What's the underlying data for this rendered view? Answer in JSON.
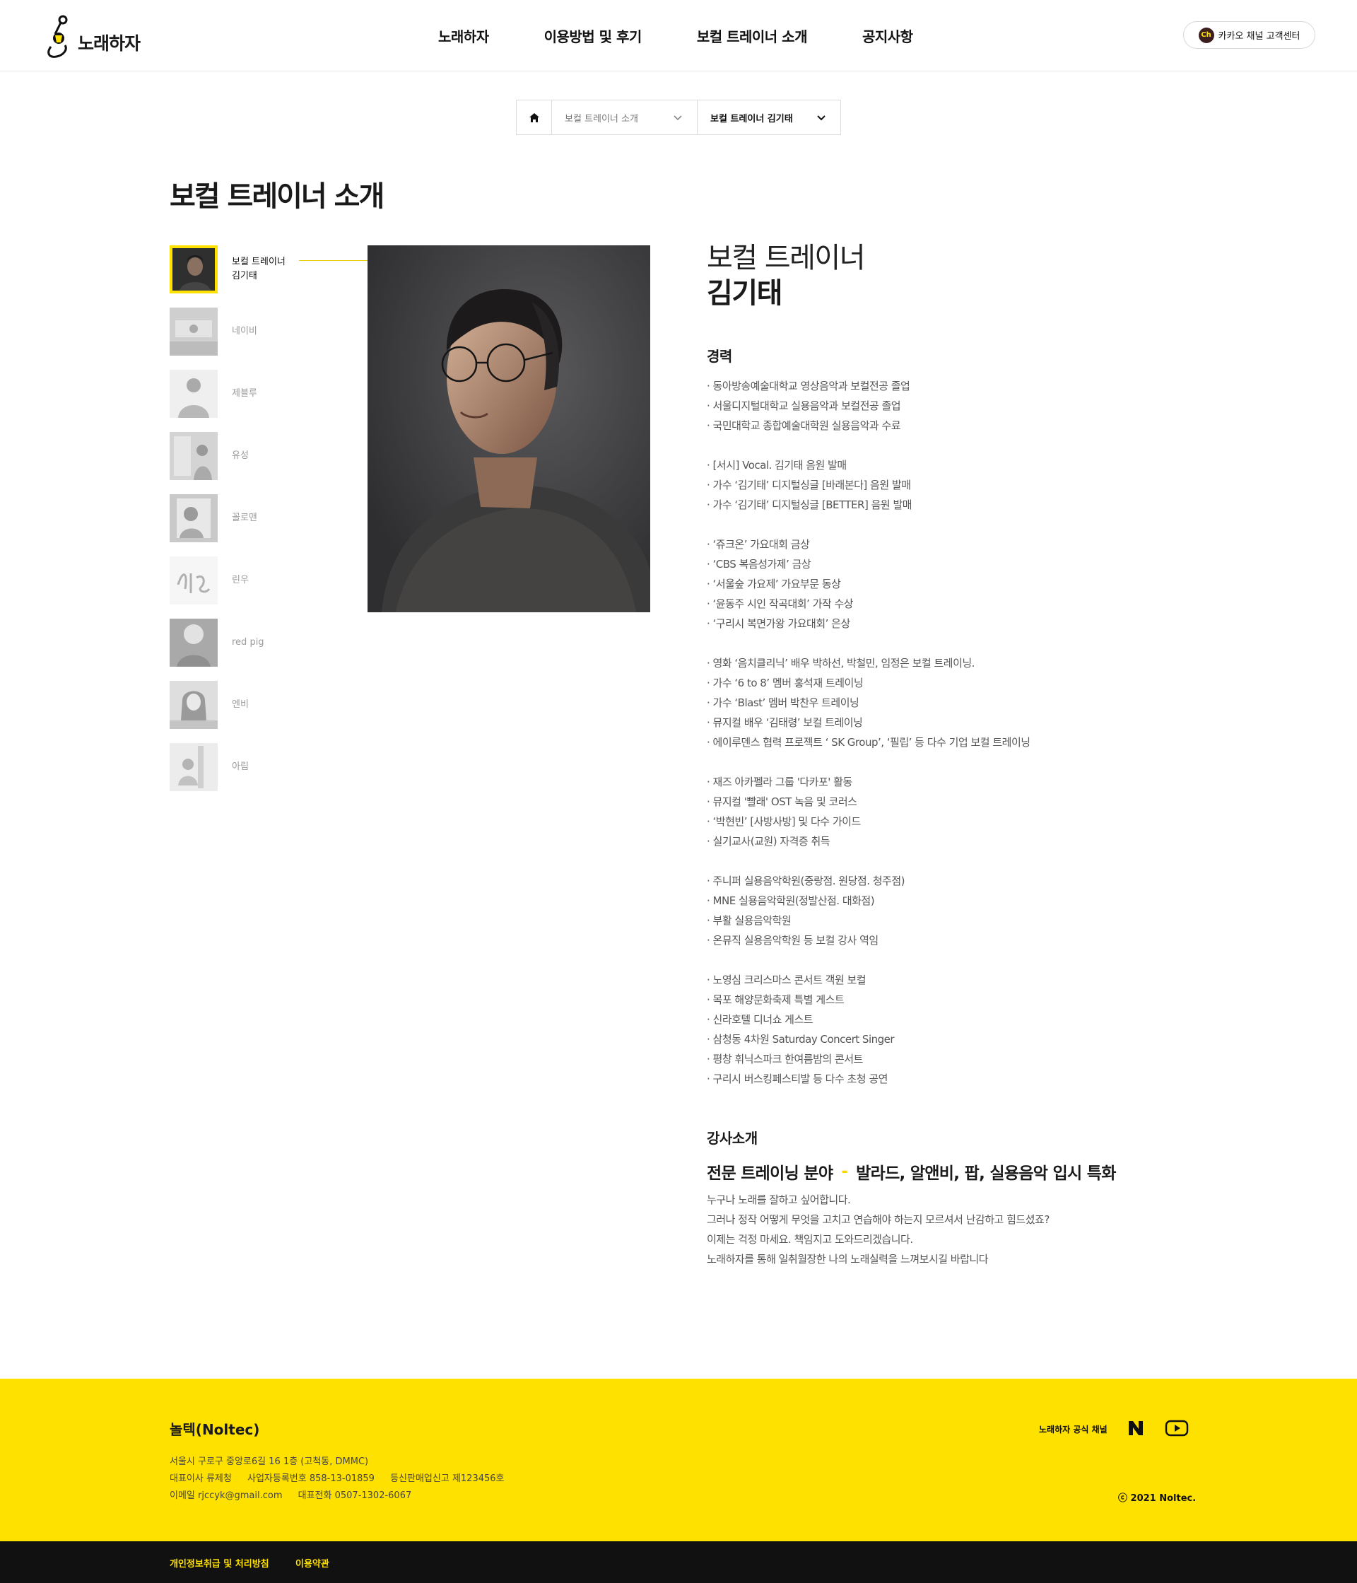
{
  "header": {
    "logo_text": "노래하자",
    "nav": [
      "노래하자",
      "이용방법 및 후기",
      "보컬 트레이너 소개",
      "공지사항"
    ],
    "active_nav": "보컬 트레이너 소개",
    "kakao_icon": "Ch",
    "kakao_label": "카카오 채널 고객센터"
  },
  "breadcrumb": {
    "home_icon": "home-icon",
    "section": "보컬 트레이너 소개",
    "current": "보컬 트레이너 김기태"
  },
  "page_title": "보컬 트레이너 소개",
  "trainers": [
    {
      "role": "보컬 트레이너",
      "name": "김기태",
      "active": true
    },
    {
      "name": "네이비"
    },
    {
      "name": "제블루"
    },
    {
      "name": "유성"
    },
    {
      "name": "꼴로맨"
    },
    {
      "name": "린우"
    },
    {
      "name": "red pig"
    },
    {
      "name": "엔비"
    },
    {
      "name": "아림"
    }
  ],
  "profile": {
    "role": "보컬 트레이너",
    "name": "김기태",
    "career_title": "경력",
    "career_groups": [
      [
        "· 동아방송예술대학교 영상음악과 보컬전공 졸업",
        "· 서울디지털대학교 실용음악과 보컬전공 졸업",
        "· 국민대학교 종합예술대학원 실용음악과 수료"
      ],
      [
        "· [서시] Vocal. 김기태 음원 발매",
        "· 가수 ‘김기태’ 디지털싱글 [바래본다] 음원 발매",
        "· 가수 ‘김기태’ 디지털싱글 [BETTER] 음원 발매"
      ],
      [
        "· ‘쥬크온’ 가요대회 금상",
        "· ‘CBS 복음성가제’ 금상",
        "· ‘서울숲 가요제’ 가요부문 동상",
        "· ‘윤동주 시인 작곡대회’ 가작 수상",
        "· ‘구리시 복면가왕 가요대회’ 은상"
      ],
      [
        "· 영화 ‘음치클리닉’ 배우 박하선, 박철민, 임정은 보컬 트레이닝.",
        "· 가수 ‘6 to 8’ 멤버 홍석재 트레이닝",
        "· 가수 ‘Blast’ 멤버 박찬우 트레이닝",
        "· 뮤지컬 배우 ‘김태령’ 보컬 트레이닝",
        "· 에이루덴스 협력 프로젝트 ‘ SK Group’, ‘필립’ 등 다수 기업 보컬 트레이닝"
      ],
      [
        "· 재즈 아카펠라 그룹 '다카포' 활동",
        "· 뮤지컬 '빨래' OST 녹음 및 코러스",
        "· ‘박현빈’ [사방사방] 및 다수 가이드",
        "· 실기교사(교원) 자격증 취득"
      ],
      [
        "· 주니퍼 실용음악학원(중랑점. 원당점. 청주점)",
        "· MNE 실용음악학원(정발산점. 대화점)",
        "· 부활 실용음악학원",
        "· 온뮤직 실용음악학원 등 보컬 강사 역임"
      ],
      [
        "· 노영심 크리스마스 콘서트 객원 보컬",
        "· 목포 해양문화축제 특별 게스트",
        "· 신라호텔 디너쇼 게스트",
        "· 삼청동 4차원 Saturday Concert Singer",
        "· 평창 휘닉스파크 한여름밤의 콘서트",
        "· 구리시 버스킹페스티발 등 다수 초청 공연"
      ]
    ],
    "intro_title": "강사소개",
    "specialty_label": "전문 트레이닝 분야",
    "specialty_dash": "-",
    "specialty_value": "발라드, 알앤비, 팝, 실용음악 입시 특화",
    "intro_lines": [
      "누구나 노래를 잘하고 싶어합니다.",
      "그러나 정작 어떻게 무엇을 고치고 연습해야 하는지 모르셔서 난감하고 힘드셨죠?",
      "이제는 걱정 마세요. 책임지고 도와드리겠습니다.",
      "노래하자를 통해 일취월장한 나의 노래실력을 느껴보시길 바랍니다"
    ]
  },
  "footer": {
    "company": "놀텍(Noltec)",
    "address": "서울시 구로구 중앙로6길 16 1층 (고척동, DMMC)",
    "ceo": "대표이사  류제청",
    "biz_no": "사업자등록번호  858-13-01859",
    "mail_order": "등신판매업신고  제123456호",
    "email": "이메일  rjccyk@gmail.com",
    "phone": "대표전화  0507-1302-6067",
    "channel_label": "노래하자 공식 채널",
    "naver_icon": "naver-icon",
    "youtube_icon": "youtube-icon",
    "copyright": "ⓒ 2021 Noltec."
  },
  "bottom_links": [
    "개인정보취급 및 처리방침",
    "이용약관"
  ],
  "colors": {
    "accent": "#ffe100",
    "text": "#1a1a1a",
    "muted": "#555555",
    "footer_bg": "#ffe100",
    "bottom_bg": "#111111"
  }
}
